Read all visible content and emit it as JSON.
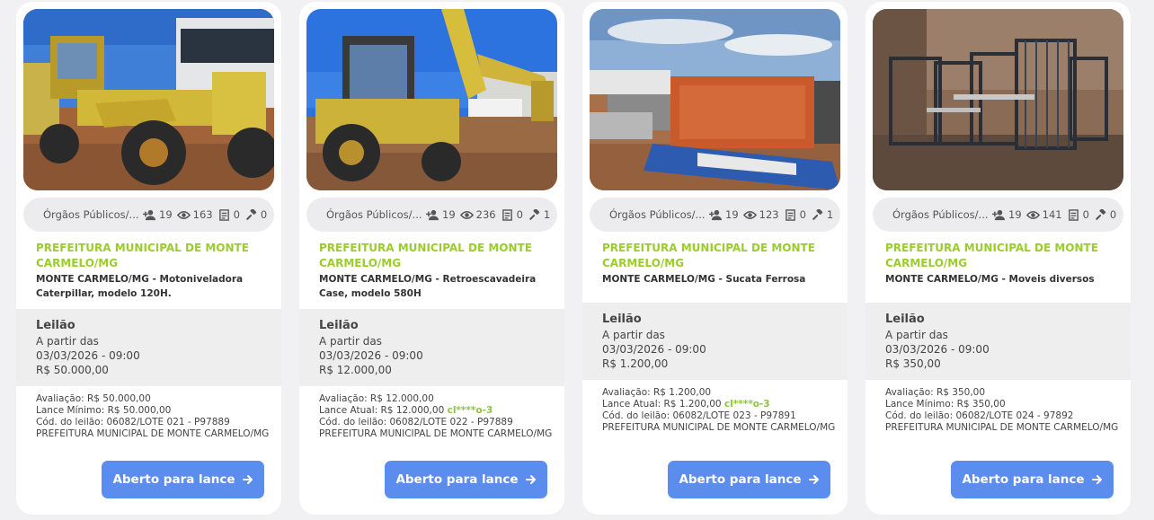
{
  "cards": [
    {
      "category": "Órgãos Públicos/...",
      "followers": "19",
      "views": "163",
      "docs": "0",
      "bids": "0",
      "seller": "PREFEITURA MUNICIPAL DE MONTE CARMELO/MG",
      "description": "MONTE CARMELO/MG - Motoniveladora Caterpillar, modelo 120H.",
      "auction_type": "Leilão",
      "starts_label": "A partir das",
      "date": "03/03/2026 - 09:00",
      "price": "R$ 50.000,00",
      "appraisal": "Avaliação: R$ 50.000,00",
      "bid_label": "Lance Mínimo: R$ 50.000,00",
      "bidder": "",
      "code": "Cód. do leilão: 06082/LOTE 021 - P97889",
      "owner": "PREFEITURA MUNICIPAL DE MONTE CARMELO/MG",
      "button": "Aberto para lance"
    },
    {
      "category": "Órgãos Públicos/...",
      "followers": "19",
      "views": "236",
      "docs": "0",
      "bids": "1",
      "seller": "PREFEITURA MUNICIPAL DE MONTE CARMELO/MG",
      "description": "MONTE CARMELO/MG - Retroescavadeira Case, modelo 580H",
      "auction_type": "Leilão",
      "starts_label": "A partir das",
      "date": "03/03/2026 - 09:00",
      "price": "R$ 12.000,00",
      "appraisal": "Avaliação: R$ 12.000,00",
      "bid_label": "Lance Atual: R$ 12.000,00",
      "bidder": "cl****o-3",
      "code": "Cód. do leilão: 06082/LOTE 022 - P97889",
      "owner": "PREFEITURA MUNICIPAL DE MONTE CARMELO/MG",
      "button": "Aberto para lance"
    },
    {
      "category": "Órgãos Públicos/...",
      "followers": "19",
      "views": "123",
      "docs": "0",
      "bids": "1",
      "seller": "PREFEITURA MUNICIPAL DE MONTE CARMELO/MG",
      "description": "MONTE CARMELO/MG - Sucata Ferrosa",
      "auction_type": "Leilão",
      "starts_label": "A partir das",
      "date": "03/03/2026 - 09:00",
      "price": "R$ 1.200,00",
      "appraisal": "Avaliação: R$ 1.200,00",
      "bid_label": "Lance Atual: R$ 1.200,00",
      "bidder": "cl****o-3",
      "code": "Cód. do leilão: 06082/LOTE 023 - P97891",
      "owner": "PREFEITURA MUNICIPAL DE MONTE CARMELO/MG",
      "button": "Aberto para lance"
    },
    {
      "category": "Órgãos Públicos/...",
      "followers": "19",
      "views": "141",
      "docs": "0",
      "bids": "0",
      "seller": "PREFEITURA MUNICIPAL DE MONTE CARMELO/MG",
      "description": "MONTE CARMELO/MG - Moveis diversos",
      "auction_type": "Leilão",
      "starts_label": "A partir das",
      "date": "03/03/2026 - 09:00",
      "price": "R$ 350,00",
      "appraisal": "Avaliação: R$ 350,00",
      "bid_label": "Lance Mínimo: R$ 350,00",
      "bidder": "",
      "code": "Cód. do leilão: 06082/LOTE 024 - 97892",
      "owner": "PREFEITURA MUNICIPAL DE MONTE CARMELO/MG",
      "button": "Aberto para lance"
    }
  ],
  "colors": {
    "seller": "#9acd2a",
    "bidder": "#8cc63e",
    "button": "#5b8dee",
    "meta_bg": "#ececee",
    "auction_bg": "#eeeeee"
  },
  "icons": [
    "user-plus-icon",
    "eye-icon",
    "document-icon",
    "gavel-icon",
    "arrow-right-icon"
  ]
}
